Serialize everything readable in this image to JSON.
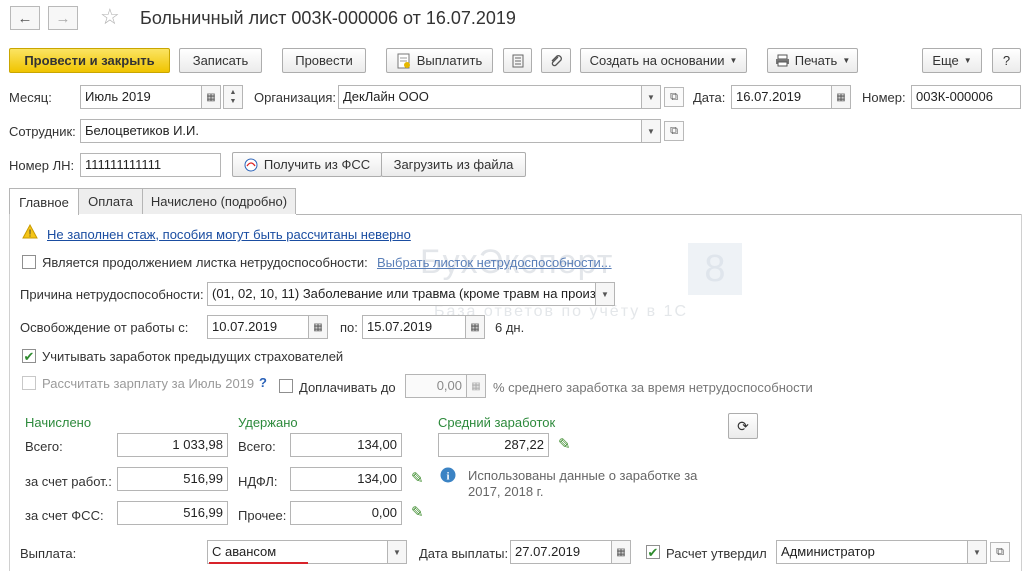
{
  "window": {
    "title": "Больничный лист 003К-000006 от 16.07.2019",
    "back_icon": "←",
    "forward_icon": "→",
    "star_icon": "☆"
  },
  "toolbar": {
    "post_close": "Провести и закрыть",
    "save": "Записать",
    "post": "Провести",
    "pay": "Выплатить",
    "create_based": "Создать на основании",
    "print": "Печать",
    "more": "Еще",
    "help": "?"
  },
  "header": {
    "month_label": "Месяц:",
    "month_value": "Июль 2019",
    "org_label": "Организация:",
    "org_value": "ДекЛайн ООО",
    "date_label": "Дата:",
    "date_value": "16.07.2019",
    "number_label": "Номер:",
    "number_value": "003К-000006",
    "employee_label": "Сотрудник:",
    "employee_value": "Белоцветиков И.И.",
    "ln_label": "Номер ЛН:",
    "ln_value": "111111111111",
    "fss_button": "Получить из ФСС",
    "load_file_button": "Загрузить из файла"
  },
  "tabs": [
    "Главное",
    "Оплата",
    "Начислено (подробно)"
  ],
  "main": {
    "warning_text": "Не заполнен стаж, пособия могут быть рассчитаны неверно",
    "continuation_label": "Является продолжением листка нетрудоспособности:",
    "continuation_link": "Выбрать листок нетрудоспособности...",
    "cause_label": "Причина нетрудоспособности:",
    "cause_value": "(01, 02, 10, 11) Заболевание или травма (кроме травм на произв",
    "release_label": "Освобождение от работы с:",
    "release_from": "10.07.2019",
    "release_to_label": "по:",
    "release_to": "15.07.2019",
    "days": "6 дн.",
    "prev_insurers_label": "Учитывать заработок предыдущих страхователей",
    "calc_salary_label": "Рассчитать зарплату за Июль 2019",
    "calc_salary_help": "?",
    "topup_label": "Доплачивать до",
    "topup_value": "0,00",
    "topup_suffix": "% среднего заработка за время нетрудоспособности"
  },
  "accrued": {
    "header": "Начислено",
    "total_label": "Всего:",
    "total_value": "1 033,98",
    "employer_label": "за счет работ.:",
    "employer_value": "516,99",
    "fss_label": "за счет ФСС:",
    "fss_value": "516,99"
  },
  "withheld": {
    "header": "Удержано",
    "total_label": "Всего:",
    "total_value": "134,00",
    "ndfl_label": "НДФЛ:",
    "ndfl_value": "134,00",
    "other_label": "Прочее:",
    "other_value": "0,00"
  },
  "average": {
    "header": "Средний заработок",
    "value": "287,22",
    "info_text_line1": "Использованы данные о заработке за",
    "info_text_line2": "2017,   2018 г."
  },
  "payment": {
    "label": "Выплата:",
    "value": "С авансом",
    "date_label": "Дата выплаты:",
    "date_value": "27.07.2019",
    "approved_label": "Расчет утвердил",
    "approved_value": "Администратор"
  },
  "watermark": {
    "brand": "БухЭксперт",
    "number": "8",
    "tagline": "База ответов по учёту в 1С"
  },
  "colors": {
    "primary_button": "#f0c400",
    "green_header": "#2d8a3c",
    "link": "#1a4da1",
    "underline_red": "#d8232a"
  }
}
